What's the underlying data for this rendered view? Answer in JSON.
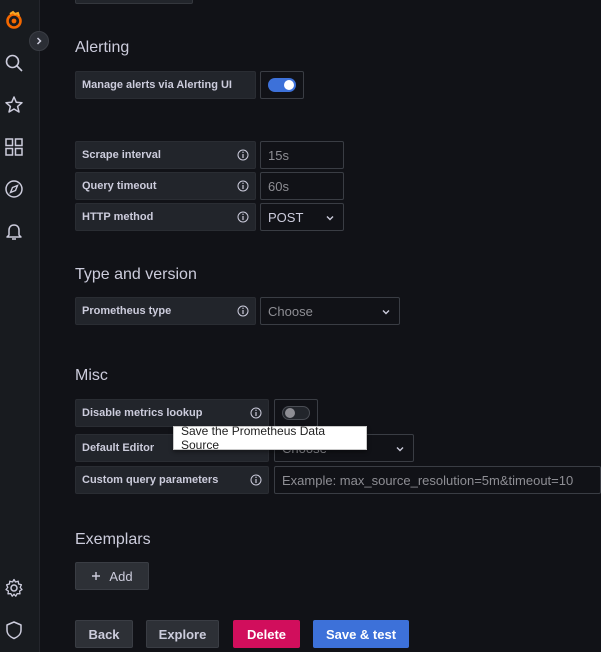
{
  "colors": {
    "accent_blue": "#3d71d9",
    "danger": "#d10e5c",
    "toggle_on": "#3d71d9",
    "logo": "#f46800"
  },
  "sidebar": {
    "icons": [
      "grafana-logo-icon",
      "search-icon",
      "star-icon",
      "dashboards-icon",
      "explore-icon",
      "alert-bell-icon",
      "gear-icon",
      "shield-icon"
    ]
  },
  "alerting": {
    "heading": "Alerting",
    "manage_label": "Manage alerts via Alerting UI",
    "manage_enabled": true
  },
  "http": {
    "scrape_label": "Scrape interval",
    "scrape_placeholder": "15s",
    "timeout_label": "Query timeout",
    "timeout_placeholder": "60s",
    "method_label": "HTTP method",
    "method_value": "POST"
  },
  "type_version": {
    "heading": "Type and version",
    "type_label": "Prometheus type",
    "type_value": "Choose"
  },
  "misc": {
    "heading": "Misc",
    "disable_lookup_label": "Disable metrics lookup",
    "disable_lookup_enabled": false,
    "editor_label": "Default Editor",
    "editor_value": "Choose",
    "custom_params_label": "Custom query parameters",
    "custom_params_placeholder": "Example: max_source_resolution=5m&timeout=10"
  },
  "exemplars": {
    "heading": "Exemplars",
    "add_label": "Add"
  },
  "tooltip": "Save the Prometheus Data Source",
  "footer": {
    "back": "Back",
    "explore": "Explore",
    "delete": "Delete",
    "save": "Save & test"
  }
}
